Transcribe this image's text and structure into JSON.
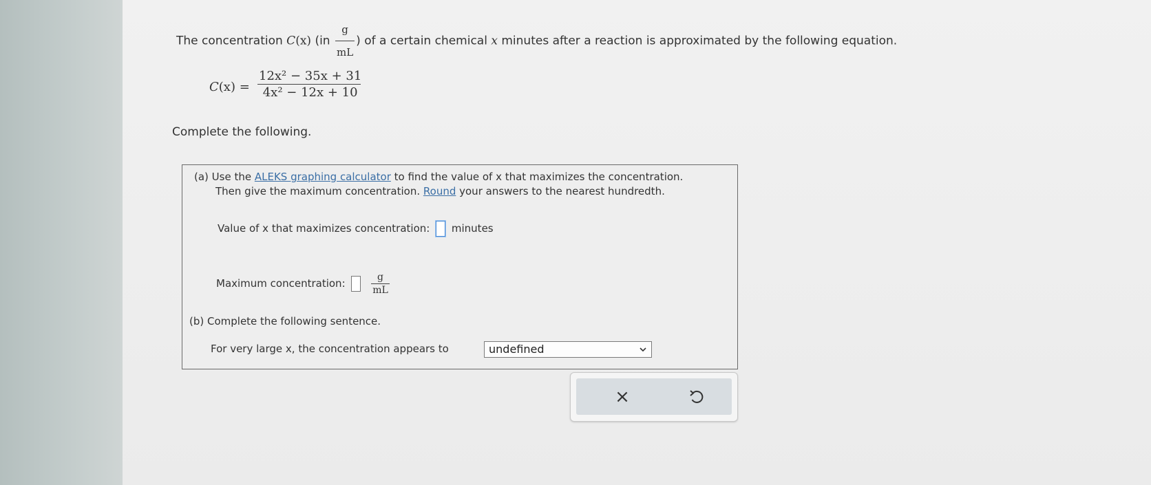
{
  "intro": {
    "prefix": "The concentration ",
    "func": "C",
    "var_paren": "(x)",
    "unit_open": " (in ",
    "unit_num": "g",
    "unit_den": "mL",
    "suffix_a": ") of a certain chemical ",
    "var": "x",
    "suffix_b": " minutes after a reaction is approximated by the following equation."
  },
  "equation": {
    "lhs": "C",
    "lhs_arg": "(x)",
    "equals": " = ",
    "numerator": "12x² − 35x + 31",
    "denominator": "4x² − 12x + 10"
  },
  "complete_label": "Complete the following.",
  "part_a": {
    "label": "(a) Use the ",
    "link": "ALEKS graphing calculator",
    "text1": " to find the value of x that maximizes the concentration.",
    "text2a": "Then give the maximum concentration. ",
    "round_link": "Round",
    "text2b": " your answers to the nearest hundredth.",
    "row1_label": "Value of x that maximizes concentration:",
    "row1_unit": "minutes",
    "row2_label": "Maximum concentration:",
    "row2_unit_num": "g",
    "row2_unit_den": "mL"
  },
  "part_b": {
    "label": "(b) Complete the following sentence.",
    "sentence": "For very large x, the concentration appears to",
    "select_value": "undefined"
  },
  "buttons": {
    "clear_glyph": "×"
  }
}
